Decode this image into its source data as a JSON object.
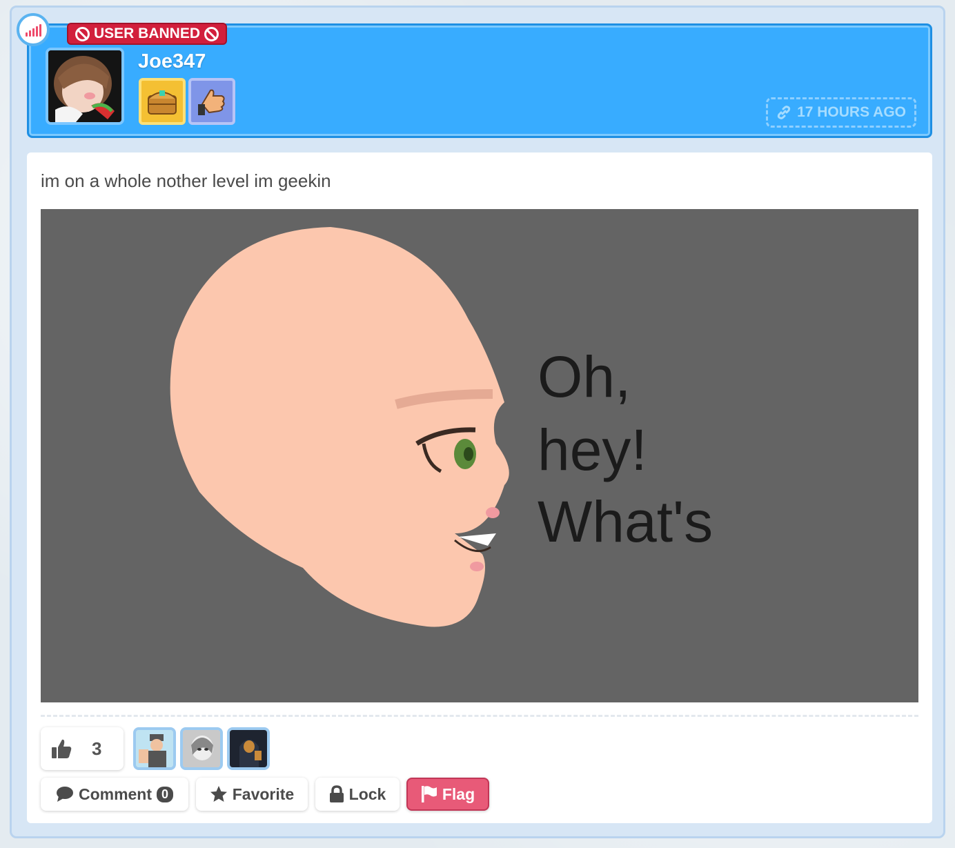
{
  "post": {
    "status_badge": "USER BANNED",
    "username": "Joe347",
    "timestamp": "17 HOURS AGO",
    "text": "im on a whole nother level im geekin",
    "image_caption_lines": [
      "Oh,",
      "hey!",
      "What's"
    ]
  },
  "reactions": {
    "like_count": "3"
  },
  "actions": {
    "comment_label": "Comment",
    "comment_count": "0",
    "favorite_label": "Favorite",
    "lock_label": "Lock",
    "flag_label": "Flag"
  },
  "colors": {
    "header": "#38acff",
    "banned": "#d21f3c",
    "flag": "#e85a78",
    "image_bg": "#646464"
  },
  "icons": [
    "signal-icon",
    "ban-icon",
    "link-icon",
    "thumbs-up-icon",
    "comment-icon",
    "star-icon",
    "lock-icon",
    "flag-icon"
  ]
}
